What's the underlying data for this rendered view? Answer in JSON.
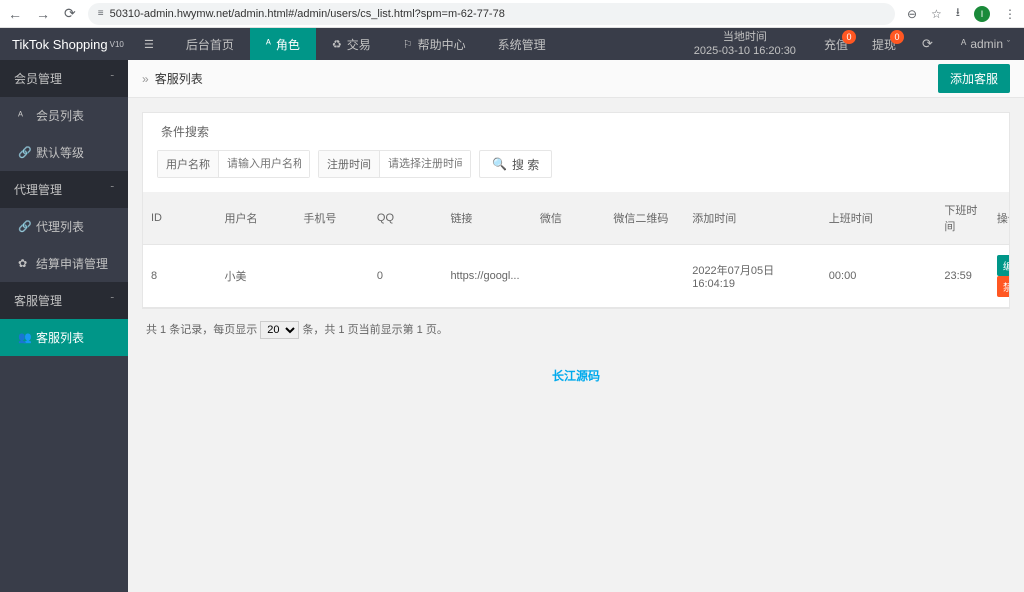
{
  "browser": {
    "url": "50310-admin.hwymw.net/admin.html#/admin/users/cs_list.html?spm=m-62-77-78",
    "avatar_initial": "I"
  },
  "logo": {
    "name": "TikTok Shopping",
    "version": "V10"
  },
  "topnav": {
    "home": "后台首页",
    "role": "角色",
    "trade": "交易",
    "help": "帮助中心",
    "system": "系统管理"
  },
  "time": {
    "label": "当地时间",
    "value": "2025-03-10 16:20:30"
  },
  "badges": {
    "recharge": "充值",
    "recharge_count": "0",
    "withdraw": "提现",
    "withdraw_count": "0"
  },
  "user": {
    "name": "admin"
  },
  "sidebar": {
    "g_member": "会员管理",
    "member_list": "会员列表",
    "default_level": "默认等级",
    "g_agent": "代理管理",
    "agent_list": "代理列表",
    "settle": "结算申请管理",
    "g_cs": "客服管理",
    "cs_list": "客服列表"
  },
  "crumb": {
    "title": "客服列表",
    "add_btn": "添加客服"
  },
  "search": {
    "title": "条件搜索",
    "username_label": "用户名称",
    "username_ph": "请输入用户名称",
    "regtime_label": "注册时间",
    "regtime_ph": "请选择注册时间",
    "btn": "搜 索"
  },
  "table": {
    "headers": {
      "id": "ID",
      "user": "用户名",
      "phone": "手机号",
      "qq": "QQ",
      "link": "链接",
      "wechat": "微信",
      "qr": "微信二维码",
      "addtime": "添加时间",
      "ontime": "上班时间",
      "offtime": "下班时间",
      "op": "操作"
    },
    "row": {
      "id": "8",
      "user": "小美",
      "phone": "",
      "qq": "0",
      "link": "https://googl...",
      "wechat": "",
      "qr": "",
      "addtime": "2022年07月05日 16:04:19",
      "ontime": "00:00",
      "offtime": "23:59"
    },
    "op_edit": "编 辑",
    "op_ban": "禁用"
  },
  "pager": {
    "prefix": "共 1 条记录，每页显示",
    "per_page": "20",
    "suffix": "条，共 1 页当前显示第 1 页。"
  },
  "footer": {
    "link": "长江源码"
  }
}
